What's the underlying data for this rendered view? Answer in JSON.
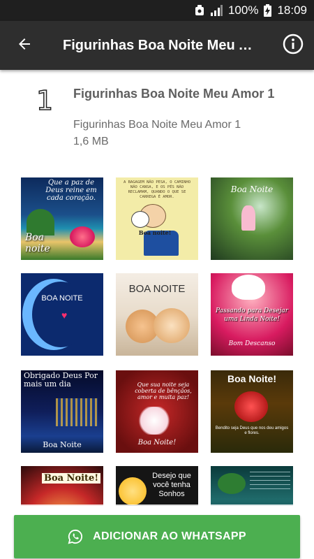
{
  "status_bar": {
    "battery": "100%",
    "time": "18:09",
    "icons": [
      "notification-icon",
      "signal-icon",
      "battery-charging-icon"
    ]
  },
  "app_bar": {
    "title": "Figurinhas Boa Noite Meu A...",
    "back_icon": "arrow-back-icon",
    "info_icon": "info-icon"
  },
  "pack": {
    "number": "1",
    "title": "Figurinhas Boa Noite Meu Amor 1",
    "name": "Figurinhas Boa Noite Meu Amor 1",
    "size": "1,6 MB"
  },
  "stickers": [
    {
      "caption": "Que a paz de Deus reine em cada coração.",
      "label": "Boa noite"
    },
    {
      "caption": "A BAGAGEM NÃO PESA, O CAMINHO NÃO CANSA, E OS PÉS NÃO RECLAMAM, QUANDO O QUE SE CARREGA É AMOR.",
      "label": "Boa noite!"
    },
    {
      "caption": "Boa Noite",
      "label": ""
    },
    {
      "caption": "BOA NOITE",
      "label": ""
    },
    {
      "caption": "BOA NOITE",
      "label": ""
    },
    {
      "caption": "Passando para Desejar uma Linda Noite!",
      "label": "Bom Descanso"
    },
    {
      "caption": "Obrigado Deus Por mais um dia",
      "label": "Boa Noite"
    },
    {
      "caption": "Que sua noite seja coberta de bênçãos, amor e muita paz!",
      "label": "Boa Noite!"
    },
    {
      "caption": "Boa Noite!",
      "label": "Bendito seja Deus que nos deu amigos e flores."
    },
    {
      "caption": "Boa Noite!",
      "label": ""
    },
    {
      "caption": "Desejo que você tenha Sonhos",
      "label": ""
    },
    {
      "caption": "",
      "label": ""
    }
  ],
  "action": {
    "label": "ADICIONAR AO WHATSAPP",
    "icon": "whatsapp-icon",
    "color": "#4caf50"
  }
}
